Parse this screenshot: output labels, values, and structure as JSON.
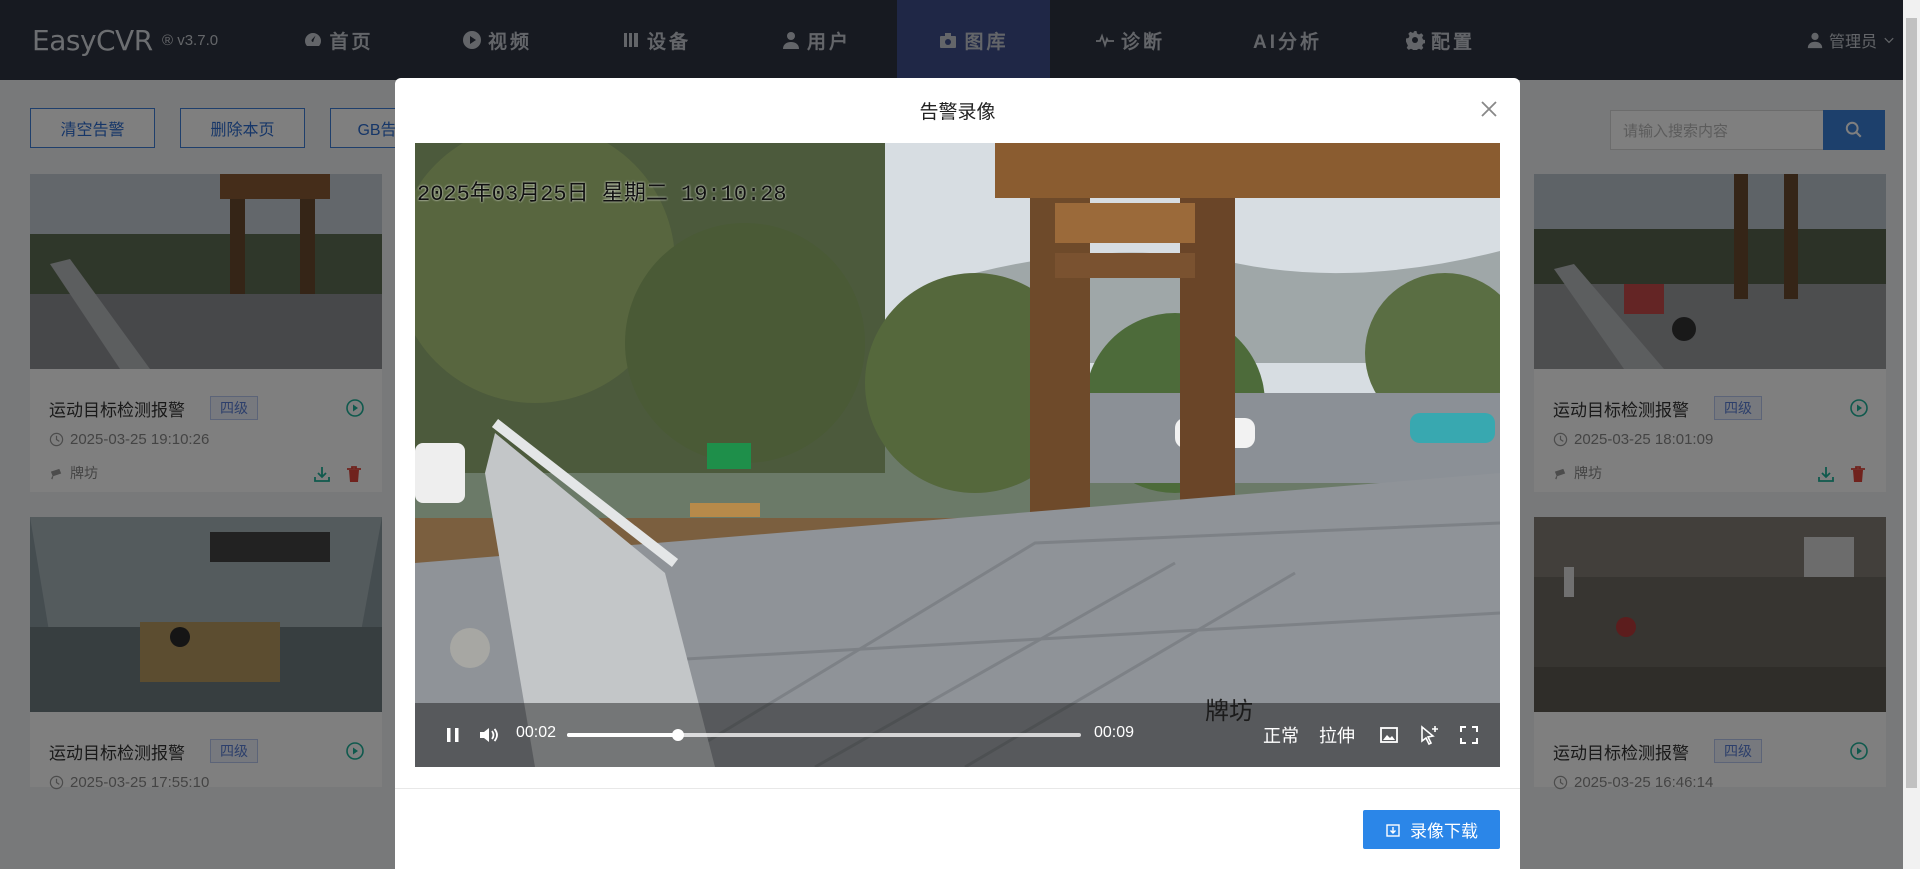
{
  "app": {
    "brand": "EasyCVR",
    "version": "® v3.7.0"
  },
  "nav": {
    "items": [
      {
        "label": "首页",
        "icon": "dashboard-icon"
      },
      {
        "label": "视频",
        "icon": "play-circle-icon"
      },
      {
        "label": "设备",
        "icon": "device-icon"
      },
      {
        "label": "用户",
        "icon": "user-icon"
      },
      {
        "label": "图库",
        "icon": "gallery-icon",
        "active": true
      },
      {
        "label": "诊断",
        "icon": "pulse-icon"
      },
      {
        "label": "AI分析",
        "icon": ""
      },
      {
        "label": "配置",
        "icon": "gear-icon"
      }
    ],
    "user": "管理员"
  },
  "toolbar": {
    "clear_alarms": "清空告警",
    "delete_page": "删除本页",
    "gb_alarms": "GB告警",
    "search_placeholder": "请输入搜索内容"
  },
  "cards": [
    {
      "title": "运动目标检测报警",
      "level": "四级",
      "time": "2025-03-25 19:10:26",
      "location": "牌坊"
    },
    {
      "title": "运动目标检测报警",
      "level": "四级",
      "time": "2025-03-25 18:01:09",
      "location": "牌坊"
    },
    {
      "title": "运动目标检测报警",
      "level": "四级",
      "time": "2025-03-25 17:55:10",
      "location": ""
    },
    {
      "title": "运动目标检测报警",
      "level": "四级",
      "time": "2025-03-25 16:46:14",
      "location": ""
    }
  ],
  "modal": {
    "title": "告警录像",
    "osd_time": "2025年03月25日 星期二 19:10:28",
    "osd_name": "牌坊",
    "player": {
      "current_time": "00:02",
      "duration": "00:09",
      "progress": 0.215,
      "mode_normal": "正常",
      "mode_stretch": "拉伸"
    },
    "download_label": "录像下载"
  },
  "colors": {
    "topbar": "#2f3542",
    "active_nav": "#3e4f8d",
    "primary": "#2b86e8"
  }
}
